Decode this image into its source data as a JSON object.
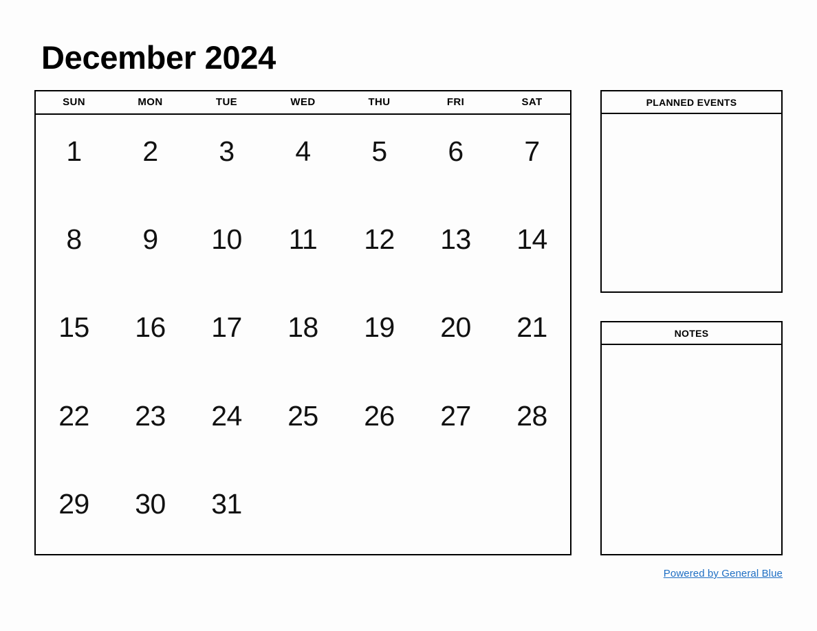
{
  "document": {
    "title": "December 2024",
    "month": "December",
    "year": "2024"
  },
  "calendar": {
    "weekday_headers": [
      "SUN",
      "MON",
      "TUE",
      "WED",
      "THU",
      "FRI",
      "SAT"
    ],
    "weeks": [
      [
        "1",
        "2",
        "3",
        "4",
        "5",
        "6",
        "7"
      ],
      [
        "8",
        "9",
        "10",
        "11",
        "12",
        "13",
        "14"
      ],
      [
        "15",
        "16",
        "17",
        "18",
        "19",
        "20",
        "21"
      ],
      [
        "22",
        "23",
        "24",
        "25",
        "26",
        "27",
        "28"
      ],
      [
        "29",
        "30",
        "31",
        "",
        "",
        "",
        ""
      ]
    ]
  },
  "panels": {
    "planned_events": {
      "header": "PLANNED EVENTS",
      "body": ""
    },
    "notes": {
      "header": "NOTES",
      "body": ""
    }
  },
  "footer": {
    "link_text": "Powered by General Blue",
    "link_color": "#1f6fc4"
  },
  "colors": {
    "background": "#fdfdfd",
    "border": "#000000",
    "text": "#000000",
    "link": "#1f6fc4"
  }
}
